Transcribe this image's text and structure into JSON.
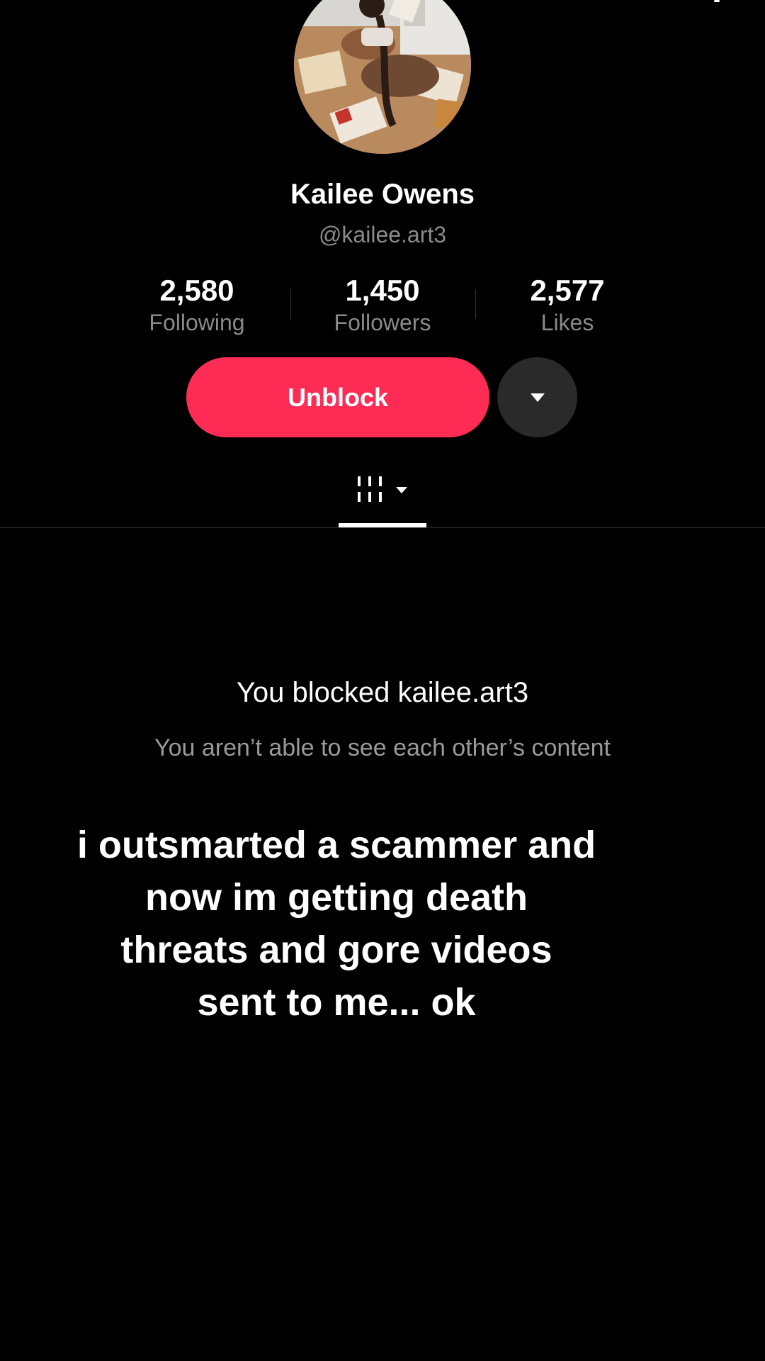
{
  "profile": {
    "name": "Kailee Owens",
    "handle": "@kailee.art3"
  },
  "stats": [
    {
      "value": "2,580",
      "label": "Following"
    },
    {
      "value": "1,450",
      "label": "Followers"
    },
    {
      "value": "2,577",
      "label": "Likes"
    }
  ],
  "actions": {
    "unblock_label": "Unblock",
    "more_icon": "caret-down-icon"
  },
  "tabs": {
    "active_icon": "grid-icon",
    "dropdown_icon": "caret-down-icon"
  },
  "blocked": {
    "title": "You blocked kailee.art3",
    "subtitle": "You aren’t able to see each other’s content"
  },
  "caption": {
    "lines": [
      "i outsmarted a scammer and",
      "now im getting death",
      "threats and gore videos",
      "sent to me... ok"
    ]
  },
  "colors": {
    "background": "#000000",
    "accent": "#fe2c55",
    "muted_text": "#8a8a8a",
    "secondary_button": "#2a2a2a"
  }
}
